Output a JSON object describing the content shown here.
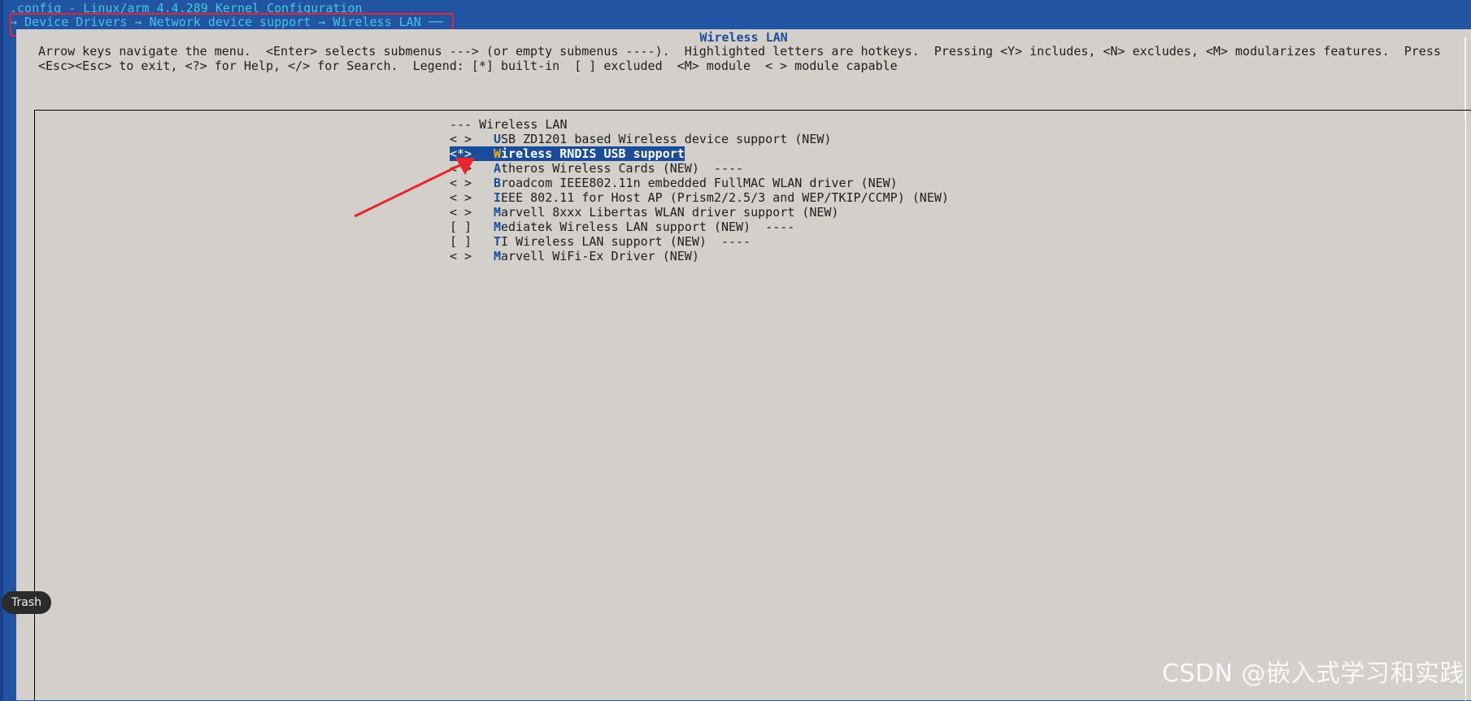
{
  "window": {
    "config_title": ".config - Linux/arm 4.4.289 Kernel Configuration",
    "breadcrumb": "→ Device Drivers → Network device support → Wireless LAN ──"
  },
  "dialog": {
    "title": "Wireless LAN",
    "help_line1": "Arrow keys navigate the menu.  <Enter> selects submenus ---> (or empty submenus ----).  Highlighted letters are hotkeys.  Pressing <Y> includes, <N> excludes, <M> modularizes features.  Press",
    "help_line2": "<Esc><Esc> to exit, <?> for Help, </> for Search.  Legend: [*] built-in  [ ] excluded  <M> module  < > module capable"
  },
  "menu": {
    "header": "--- Wireless LAN",
    "items": [
      {
        "sel": "< >",
        "hot": "U",
        "rest": "SB ZD1201 based Wireless device support (NEW)"
      },
      {
        "sel": "<*>",
        "hot": "W",
        "rest": "ireless RNDIS USB support"
      },
      {
        "sel": "< >",
        "hot": "A",
        "rest": "theros Wireless Cards (NEW)  ----"
      },
      {
        "sel": "< >",
        "hot": "B",
        "rest": "roadcom IEEE802.11n embedded FullMAC WLAN driver (NEW)"
      },
      {
        "sel": "< >",
        "hot": "I",
        "rest": "EEE 802.11 for Host AP (Prism2/2.5/3 and WEP/TKIP/CCMP) (NEW)"
      },
      {
        "sel": "< >",
        "hot": "M",
        "rest": "arvell 8xxx Libertas WLAN driver support (NEW)"
      },
      {
        "sel": "[ ]",
        "hot": "M",
        "rest": "ediatek Wireless LAN support (NEW)  ----"
      },
      {
        "sel": "[ ]",
        "hot": "T",
        "rest": "I Wireless LAN support (NEW)  ----"
      },
      {
        "sel": "< >",
        "hot": "M",
        "rest": "arvell WiFi-Ex Driver (NEW)"
      }
    ]
  },
  "dock": {
    "trash_label": "Trash"
  },
  "watermark": "CSDN @嵌入式学习和实践",
  "colors": {
    "background": "#2155a3",
    "dialog": "#d3d0cb",
    "highlight": "#1b4c9a",
    "cyan_text": "#4ec1df",
    "annotation_red": "#e8252d"
  }
}
